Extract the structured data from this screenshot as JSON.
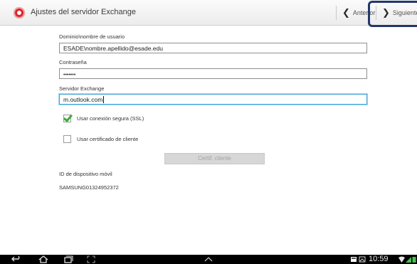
{
  "header": {
    "app_icon": "email-app-icon",
    "title": "Ajustes del servidor Exchange",
    "prev_label": "Anterior",
    "next_label": "Siguiente",
    "highlight_color": "#22386a"
  },
  "form": {
    "domain_user": {
      "label": "Dominio\\nombre de usuario",
      "value": "ESADE\\nombre.apellido@esade.edu"
    },
    "password": {
      "label": "Contraseña",
      "value": "•••••••"
    },
    "server": {
      "label": "Servidor Exchange",
      "value": "m.outlook.com"
    },
    "ssl": {
      "label": "Usar conexión segura (SSL)",
      "checked": true
    },
    "client_cert": {
      "label": "Usar certificado de cliente",
      "checked": false
    },
    "cert_button_label": "Certif. cliente",
    "device_id_label": "ID de dispositivo móvil",
    "device_id_value": "SAMSUNG01324952372"
  },
  "system_bar": {
    "back": "back-icon",
    "home": "home-icon",
    "recents": "recent-apps-icon",
    "screenshot": "screenshot-icon",
    "up": "chevron-up-icon",
    "time": "10:59",
    "accent_green": "#3cab3c",
    "focus_blue": "#3fa4d6"
  }
}
